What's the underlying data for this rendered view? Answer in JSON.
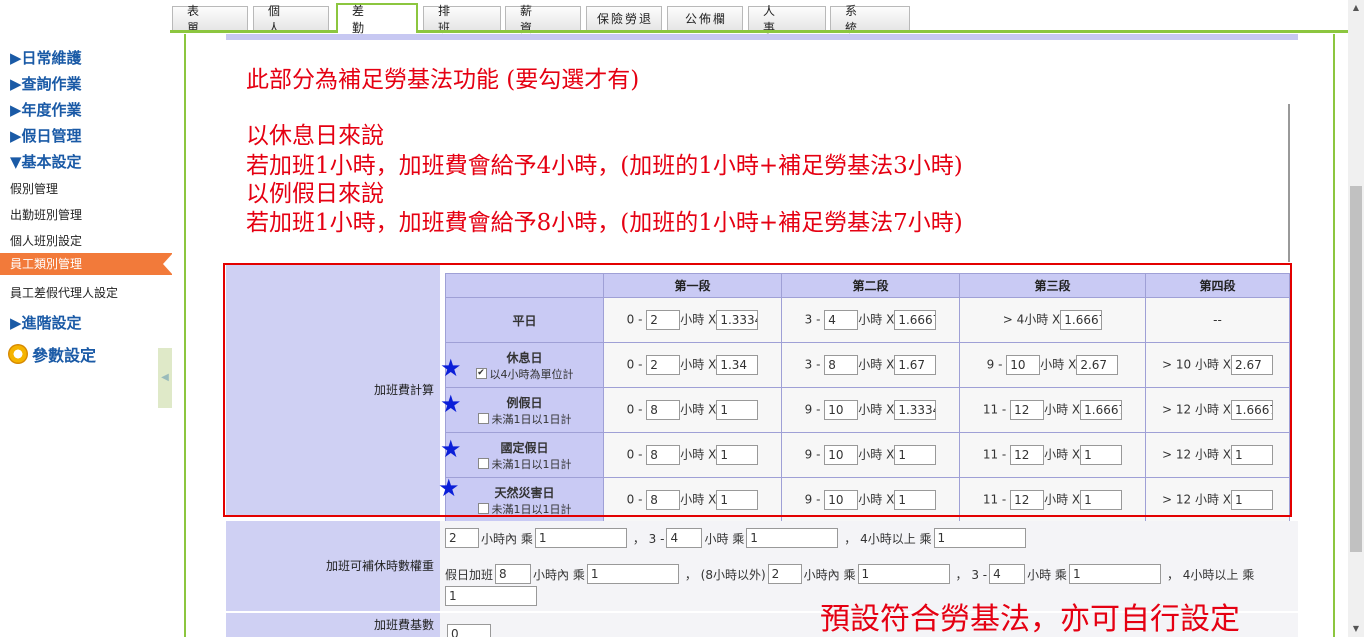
{
  "tabs": [
    "表 單",
    "個 人",
    "差 勤",
    "排 班",
    "薪 資",
    "保險勞退",
    "公佈欄",
    "人 事",
    "系 統"
  ],
  "sidebar": {
    "heads": [
      "▶日常維護",
      "▶查詢作業",
      "▶年度作業",
      "▶假日管理",
      "▼基本設定"
    ],
    "subs": [
      "假別管理",
      "出勤班別管理",
      "個人班別設定",
      "員工類別管理",
      "員工差假代理人設定"
    ],
    "advanced": "▶進階設定",
    "param": "參數設定"
  },
  "notes": {
    "line1": "此部分為補足勞基法功能 (要勾選才有)",
    "line2": "以休息日來說",
    "line3": "若加班1小時，加班費會給予4小時，(加班的1小時+補足勞基法3小時)",
    "line4": "以例假日來說",
    "line5": "若加班1小時，加班費會給予8小時，(加班的1小時+補足勞基法7小時)",
    "bottom": "預設符合勞基法，亦可自行設定"
  },
  "overtime": {
    "label": "加班費計算",
    "headers": [
      "第一段",
      "第二段",
      "第三段",
      "第四段"
    ],
    "unit": "小時 X",
    "rows": {
      "weekday": {
        "name": "平日",
        "s1a": "0 -",
        "s1v": "2",
        "s1m": "1.3334",
        "s2a": "3 -",
        "s2v": "4",
        "s2m": "1.6667",
        "s3a": "> 4小時 X",
        "s3m": "1.6667",
        "s4": "--"
      },
      "rest": {
        "name": "休息日",
        "cb": "以4小時為單位計",
        "s1a": "0 -",
        "s1v": "2",
        "s1m": "1.34",
        "s2a": "3 -",
        "s2v": "8",
        "s2m": "1.67",
        "s3a": "9 -",
        "s3v": "10",
        "s3m": "2.67",
        "s4a": "> 10 小時 X",
        "s4m": "2.67"
      },
      "regular": {
        "name": "例假日",
        "cb": "未滿1日以1日計",
        "s1a": "0 -",
        "s1v": "8",
        "s1m": "1",
        "s2a": "9 -",
        "s2v": "10",
        "s2m": "1.3334",
        "s3a": "11 -",
        "s3v": "12",
        "s3m": "1.6667",
        "s4a": "> 12 小時 X",
        "s4m": "1.6667"
      },
      "fixed": {
        "name": "國定假日",
        "cb": "未滿1日以1日計",
        "s1a": "0 -",
        "s1v": "8",
        "s1m": "1",
        "s2a": "9 -",
        "s2v": "10",
        "s2m": "1",
        "s3a": "11 -",
        "s3v": "12",
        "s3m": "1",
        "s4a": "> 12 小時 X",
        "s4m": "1"
      },
      "disaster": {
        "name": "天然災害日",
        "cb": "未滿1日以1日計",
        "s1a": "0 -",
        "s1v": "8",
        "s1m": "1",
        "s2a": "9 -",
        "s2v": "10",
        "s2m": "1",
        "s3a": "11 -",
        "s3v": "12",
        "s3m": "1",
        "s4a": "> 12 小時 X",
        "s4m": "1"
      }
    }
  },
  "compensatory": {
    "label": "加班可補休時數權重",
    "l1": {
      "v1": "2",
      "t1": "小時內 乘",
      "m1": "1",
      "t2": "， 3 -",
      "v2": "4",
      "t3": "小時 乘",
      "m2": "1",
      "t4": "， 4小時以上 乘",
      "m3": "1"
    },
    "l2": {
      "t0": "假日加班",
      "v1": "8",
      "t1": "小時內 乘",
      "m1": "1",
      "t2": "， (8小時以外)",
      "v2": "2",
      "t3": "小時內 乘",
      "m2": "1",
      "t4": "， 3 -",
      "v3": "4",
      "t5": "小時 乘",
      "m3": "1",
      "t6": "， 4小時以上 乘",
      "m4": "1"
    }
  },
  "base": {
    "label": "加班費基數",
    "value": "0"
  }
}
